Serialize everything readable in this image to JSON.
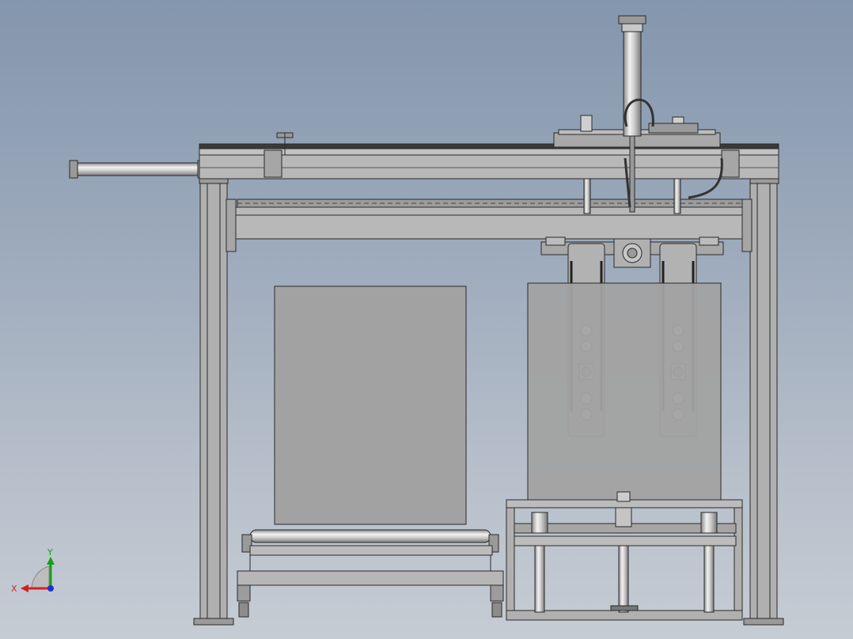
{
  "view": {
    "triad": {
      "x_label": "X",
      "y_label": "Y",
      "x_color": "#d42020",
      "y_color": "#18a018",
      "z_color": "#2030d0"
    }
  },
  "colors": {
    "background_top": "#8496ad",
    "background_bottom": "#c6ccd4",
    "steel": "#b3b3b3",
    "steel_dark": "#8c8c8c",
    "panel": "#a0a0a0",
    "edge": "#2a2a2a"
  }
}
